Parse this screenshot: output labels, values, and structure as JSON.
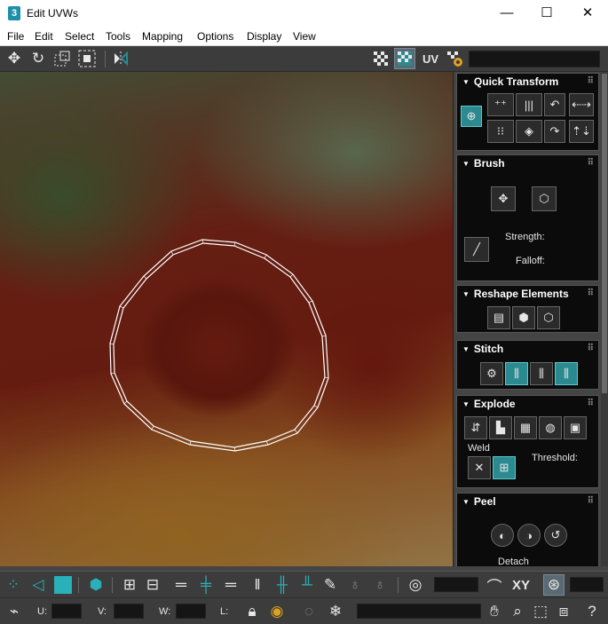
{
  "window": {
    "app_badge": "3",
    "title": "Edit UVWs",
    "minimize": "—",
    "maximize": "☐",
    "close": "✕"
  },
  "menu": {
    "file": "File",
    "edit": "Edit",
    "select": "Select",
    "tools": "Tools",
    "mapping": "Mapping",
    "options": "Options",
    "display": "Display",
    "view": "View"
  },
  "toolbar_top": {
    "uv_label": "UV",
    "field_value": ""
  },
  "panel": {
    "quick_transform": {
      "title": "Quick Transform"
    },
    "brush": {
      "title": "Brush",
      "strength_label": "Strength:",
      "falloff_label": "Falloff:"
    },
    "reshape": {
      "title": "Reshape Elements"
    },
    "stitch": {
      "title": "Stitch"
    },
    "explode": {
      "title": "Explode",
      "weld_label": "Weld",
      "threshold_label": "Threshold:"
    },
    "peel": {
      "title": "Peel",
      "detach_label": "Detach"
    }
  },
  "bottom1": {
    "xy_label": "XY",
    "value_field": "",
    "value_field2": ""
  },
  "bottom2": {
    "u_label": "U:",
    "v_label": "V:",
    "w_label": "W:",
    "l_label": "L:",
    "u_value": "",
    "v_value": "",
    "w_value": "",
    "l_value": ""
  },
  "colors": {
    "accent": "#2a8a90",
    "viewport_overlay": "#ffffff",
    "panel_bg": "#0b0b0b"
  }
}
